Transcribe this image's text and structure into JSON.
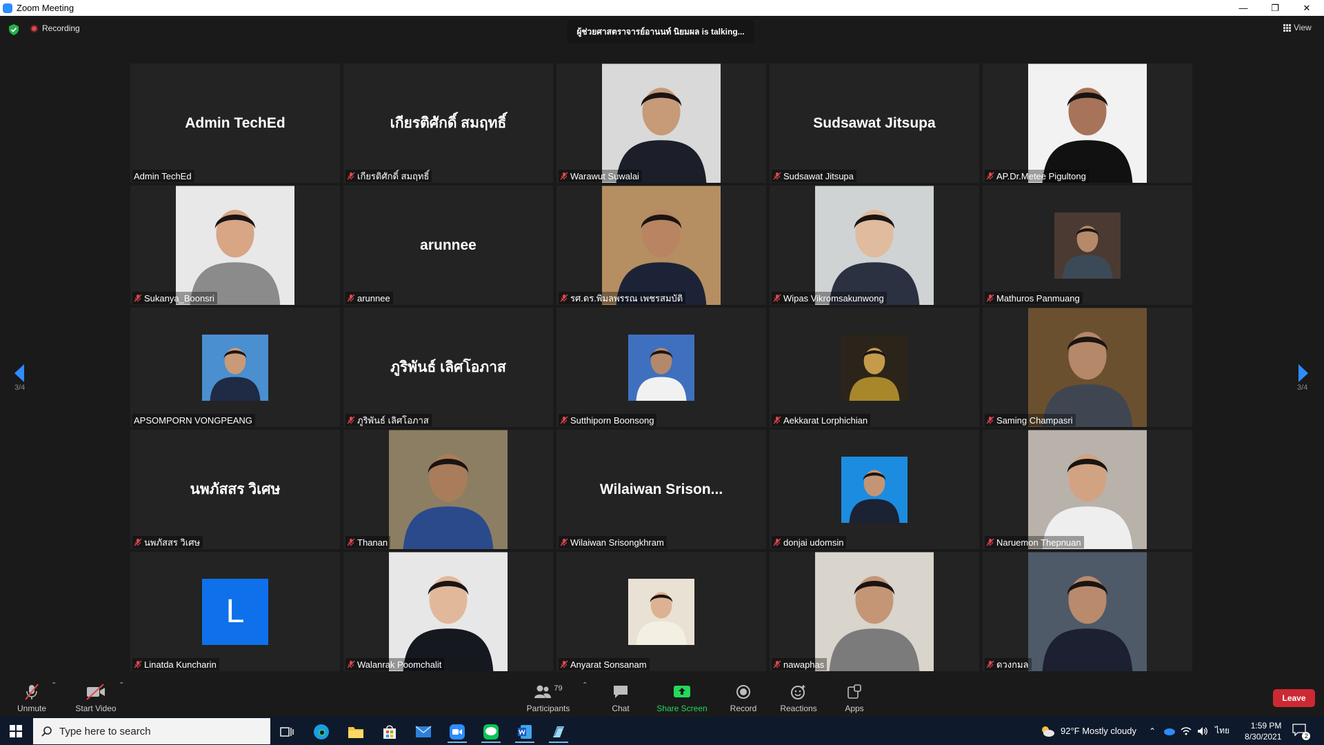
{
  "window": {
    "title": "Zoom Meeting"
  },
  "meeting": {
    "recording_label": "Recording",
    "talking": "ผู้ช่วยศาสตราจารย์อานนท์ นิยมผล is talking...",
    "view_label": "View",
    "page_left": "3/4",
    "page_right": "3/4"
  },
  "participants": [
    {
      "big": "Admin TechEd",
      "name": "Admin TechEd",
      "muted": false
    },
    {
      "big": "เกียรติศักดิ์ สมฤทธิ์",
      "name": "เกียรติศักดิ์ สมฤทธิ์",
      "muted": true
    },
    {
      "name": "Warawut Suwalai",
      "muted": true,
      "photo": {
        "bg": "#d9d9d9",
        "body": "#1c1f2a",
        "face": "#c79a78"
      }
    },
    {
      "big": "Sudsawat Jitsupa",
      "name": "Sudsawat Jitsupa",
      "muted": true
    },
    {
      "name": "AP.Dr.Metee Pigultong",
      "muted": true,
      "photo": {
        "bg": "#f2f2f2",
        "body": "#111111",
        "face": "#a7745a"
      }
    },
    {
      "name": "Sukanya_Boonsri",
      "muted": true,
      "photo": {
        "bg": "#e8e8e8",
        "body": "#8b8b8b",
        "face": "#d8a585"
      }
    },
    {
      "big": "arunnee",
      "name": "arunnee",
      "muted": true
    },
    {
      "name": "รศ.ดร.พิมลพรรณ เพชรสมบัติ",
      "muted": true,
      "photo": {
        "bg": "#b58f62",
        "body": "#1d2336",
        "face": "#b98462"
      }
    },
    {
      "name": "Wipas Vikromsakunwong",
      "muted": true,
      "photo": {
        "bg": "#cfd3d4",
        "body": "#2b3140",
        "face": "#e0bb9e"
      }
    },
    {
      "name": "Mathuros Panmuang",
      "muted": true,
      "photo": {
        "bg": "#4a3a32",
        "body": "#3c4a58",
        "face": "#b5896a",
        "small": true
      }
    },
    {
      "name": "APSOMPORN VONGPEANG",
      "muted": false,
      "photo": {
        "bg": "#4a8fcf",
        "body": "#1f2a44",
        "face": "#c99a78",
        "small": true
      }
    },
    {
      "big": "ภูริพันธ์ เลิศโอภาส",
      "name": "ภูริพันธ์ เลิศโอภาส",
      "muted": true
    },
    {
      "name": "Sutthiporn Boonsong",
      "muted": true,
      "photo": {
        "bg": "#3f6fbf",
        "body": "#f1f1f1",
        "face": "#b4886a",
        "small": true
      }
    },
    {
      "name": "Aekkarat Lorphichian",
      "muted": true,
      "photo": {
        "bg": "#2b241a",
        "body": "#a8872b",
        "face": "#c39b4a",
        "small": true
      }
    },
    {
      "name": "Saming Champasri",
      "muted": true,
      "photo": {
        "bg": "#6b5030",
        "body": "#404552",
        "face": "#b58869"
      }
    },
    {
      "big": "นพภัสสร วิเศษ",
      "name": "นพภัสสร วิเศษ",
      "muted": true
    },
    {
      "name": "Thanan",
      "muted": true,
      "photo": {
        "bg": "#8c7e62",
        "body": "#2b4a8c",
        "face": "#a97d5c"
      }
    },
    {
      "big": "Wilaiwan  Srison...",
      "name": "Wilaiwan Srisongkhram",
      "muted": true
    },
    {
      "name": "donjai udomsin",
      "muted": true,
      "photo": {
        "bg": "#1c8ce0",
        "body": "#1b2233",
        "face": "#c39574",
        "small": true
      }
    },
    {
      "name": "Naruemon Thepnuan",
      "muted": true,
      "photo": {
        "bg": "#b9b2aa",
        "body": "#eeeeee",
        "face": "#d2a382"
      }
    },
    {
      "letter": "L",
      "name": "Linatda Kuncharin",
      "muted": true
    },
    {
      "name": "Walanrak Poomchalit",
      "muted": true,
      "photo": {
        "bg": "#e7e7e7",
        "body": "#16181f",
        "face": "#e2b89b"
      }
    },
    {
      "name": "Anyarat Sonsanam",
      "muted": true,
      "photo": {
        "bg": "#e9e2d4",
        "body": "#f4efe3",
        "face": "#ddb293",
        "small": true
      }
    },
    {
      "name": "nawaphas",
      "muted": true,
      "photo": {
        "bg": "#d9d4cc",
        "body": "#7b7b7b",
        "face": "#c49676"
      }
    },
    {
      "name": "ดวงกมล",
      "muted": true,
      "photo": {
        "bg": "#4e5a68",
        "body": "#1c2030",
        "face": "#b98b6c"
      }
    }
  ],
  "controls": {
    "unmute": "Unmute",
    "start_video": "Start Video",
    "participants": "Participants",
    "participant_count": "79",
    "chat": "Chat",
    "share_screen": "Share Screen",
    "record": "Record",
    "reactions": "Reactions",
    "apps": "Apps",
    "leave": "Leave"
  },
  "taskbar": {
    "search_placeholder": "Type here to search",
    "weather": "92°F  Mostly cloudy",
    "lang": "ไทย",
    "time": "1:59 PM",
    "date": "8/30/2021",
    "notifications": "2"
  },
  "colors": {
    "accent_blue": "#2d8cff",
    "leave_red": "#cc2933",
    "share_green": "#23d959",
    "mute_red": "#e0464d"
  }
}
